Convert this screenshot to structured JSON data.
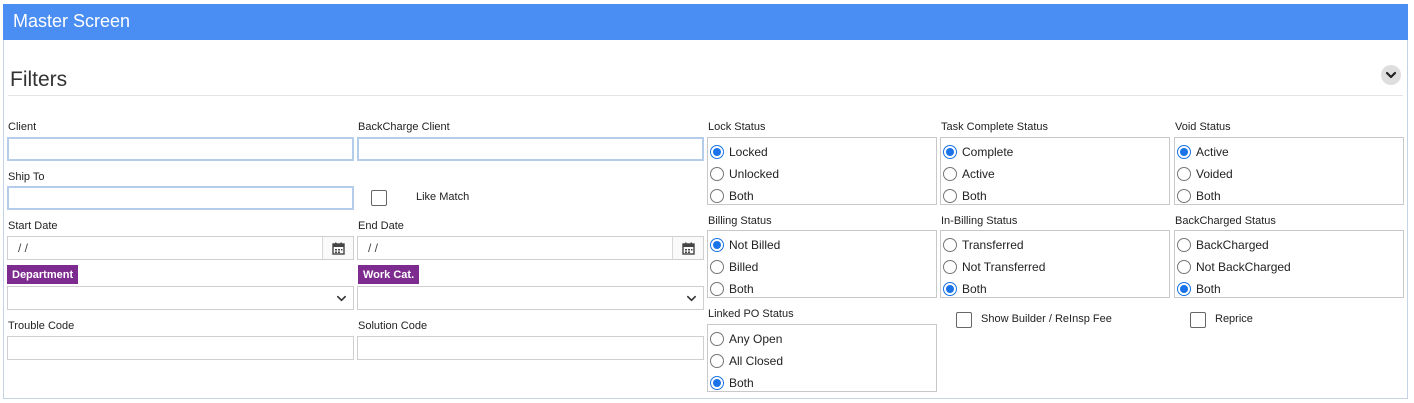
{
  "header": {
    "title": "Master Screen"
  },
  "filters": {
    "title": "Filters"
  },
  "fields": {
    "client": {
      "label": "Client",
      "value": ""
    },
    "backcharge_client": {
      "label": "BackCharge Client",
      "value": ""
    },
    "ship_to": {
      "label": "Ship To",
      "value": ""
    },
    "like_match": {
      "label": "Like Match",
      "checked": false
    },
    "start_date": {
      "label": "Start Date",
      "value": "/ /"
    },
    "end_date": {
      "label": "End Date",
      "value": "/ /"
    },
    "department": {
      "label": "Department",
      "value": ""
    },
    "work_cat": {
      "label": "Work Cat.",
      "value": ""
    },
    "trouble_code": {
      "label": "Trouble Code",
      "value": ""
    },
    "solution_code": {
      "label": "Solution Code",
      "value": ""
    }
  },
  "radio_groups": {
    "lock_status": {
      "label": "Lock Status",
      "options": [
        "Locked",
        "Unlocked",
        "Both"
      ],
      "selected": "Locked"
    },
    "task_complete_status": {
      "label": "Task Complete Status",
      "options": [
        "Complete",
        "Active",
        "Both"
      ],
      "selected": "Complete"
    },
    "void_status": {
      "label": "Void Status",
      "options": [
        "Active",
        "Voided",
        "Both"
      ],
      "selected": "Active"
    },
    "billing_status": {
      "label": "Billing Status",
      "options": [
        "Not Billed",
        "Billed",
        "Both"
      ],
      "selected": "Not Billed"
    },
    "in_billing_status": {
      "label": "In-Billing Status",
      "options": [
        "Transferred",
        "Not Transferred",
        "Both"
      ],
      "selected": "Both"
    },
    "backcharged_status": {
      "label": "BackCharged Status",
      "options": [
        "BackCharged",
        "Not BackCharged",
        "Both"
      ],
      "selected": "Both"
    },
    "linked_po_status": {
      "label": "Linked PO Status",
      "options": [
        "Any Open",
        "All Closed",
        "Both"
      ],
      "selected": "Both"
    }
  },
  "checkboxes": {
    "show_builder": {
      "label": "Show Builder / ReInsp Fee",
      "checked": false
    },
    "reprice": {
      "label": "Reprice",
      "checked": false
    }
  },
  "colors": {
    "header_bg": "#4a8ef3",
    "tag_bg": "#7d2b8f",
    "radio_accent": "#1a73e8"
  },
  "icons": {
    "collapse": "chevron-down-icon",
    "calendar": "calendar-icon",
    "select": "chevron-down-icon"
  }
}
